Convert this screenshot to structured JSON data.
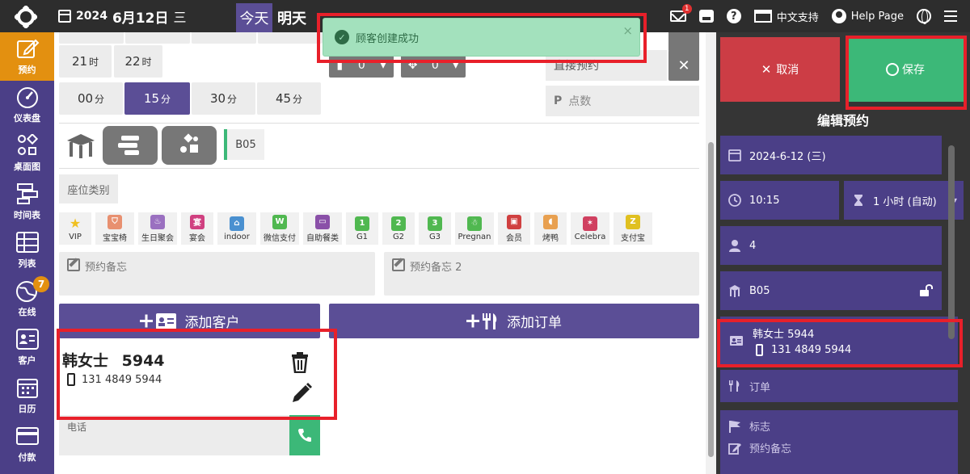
{
  "topbar": {
    "year": "2024",
    "month_day": "6月12日",
    "weekday": "三",
    "today_label": "今天",
    "tomorrow_label": "明天",
    "mail_badge": "1",
    "language_label": "中文支持",
    "help_label": "Help Page"
  },
  "sidebar": {
    "items": [
      {
        "label": "预约",
        "icon": "edit-icon"
      },
      {
        "label": "仪表盘",
        "icon": "dashboard-icon"
      },
      {
        "label": "桌面图",
        "icon": "floorplan-icon"
      },
      {
        "label": "时间表",
        "icon": "timeline-icon"
      },
      {
        "label": "列表",
        "icon": "list-icon"
      },
      {
        "label": "在线",
        "icon": "globe-icon",
        "badge": "7"
      },
      {
        "label": "客户",
        "icon": "customer-icon"
      },
      {
        "label": "日历",
        "icon": "calendar-icon"
      },
      {
        "label": "付款",
        "icon": "payment-icon"
      }
    ]
  },
  "time": {
    "hours": [
      {
        "num": "21",
        "unit": "时"
      },
      {
        "num": "22",
        "unit": "时"
      }
    ],
    "minutes": [
      {
        "num": "00",
        "unit": "分"
      },
      {
        "num": "15",
        "unit": "分",
        "selected": true
      },
      {
        "num": "30",
        "unit": "分"
      },
      {
        "num": "45",
        "unit": "分"
      }
    ]
  },
  "top_partial": {
    "spinner_a": "0",
    "spinner_b": "0",
    "direct_booking": "直接预约",
    "points_placeholder": "点数"
  },
  "table": {
    "number": "B05",
    "seat_category": "座位类别"
  },
  "tags": [
    {
      "label": "VIP",
      "icon": "star-icon",
      "color": "#f0c020",
      "glyph": "★"
    },
    {
      "label": "宝宝椅",
      "icon": "highchair-icon",
      "color": "#e89070",
      "glyph": "⛉"
    },
    {
      "label": "生日聚会",
      "icon": "cake-icon",
      "color": "#9a70c0",
      "glyph": "♨"
    },
    {
      "label": "宴会",
      "icon": "banquet-icon",
      "color": "#d04080",
      "glyph": "宴"
    },
    {
      "label": "indoor",
      "icon": "bed-icon",
      "color": "#4a90d0",
      "glyph": "⌂"
    },
    {
      "label": "微信支付",
      "icon": "wechat-icon",
      "color": "#50b850",
      "glyph": "W"
    },
    {
      "label": "自助餐类",
      "icon": "buffet-icon",
      "color": "#8a50a8",
      "glyph": "▭"
    },
    {
      "label": "G1",
      "icon": "g1-icon",
      "color": "#50b850",
      "glyph": "1"
    },
    {
      "label": "G2",
      "icon": "g2-icon",
      "color": "#50b850",
      "glyph": "2"
    },
    {
      "label": "G3",
      "icon": "g3-icon",
      "color": "#50b850",
      "glyph": "3"
    },
    {
      "label": "Pregnan",
      "icon": "pregnant-icon",
      "color": "#50b850",
      "glyph": "☃"
    },
    {
      "label": "会员",
      "icon": "member-card-icon",
      "color": "#d04040",
      "glyph": "▣"
    },
    {
      "label": "烤鸭",
      "icon": "drumstick-icon",
      "color": "#e8a050",
      "glyph": "◖"
    },
    {
      "label": "Celebra",
      "icon": "party-icon",
      "color": "#d04060",
      "glyph": "✶"
    },
    {
      "label": "支付宝",
      "icon": "alipay-icon",
      "color": "#e0c020",
      "glyph": "Z"
    }
  ],
  "notes": {
    "note1_placeholder": "预约备忘",
    "note2_placeholder": "预约备忘 2"
  },
  "buttons": {
    "add_customer": "添加客户",
    "add_order": "添加订单"
  },
  "customer": {
    "name": "韩女士",
    "id": "5944",
    "phone": "131 4849 5944",
    "phone_field_placeholder": "电话"
  },
  "toast": {
    "message": "顾客创建成功",
    "close": "×"
  },
  "right_panel": {
    "cancel_label": "取消",
    "save_label": "保存",
    "title": "编辑预约",
    "date": "2024-6-12 (三)",
    "time": "10:15",
    "duration": "1 小时 (自动)",
    "guests": "4",
    "table": "B05",
    "customer_name": "韩女士 5944",
    "customer_phone": "131 4849 5944",
    "order_label": "订单",
    "flag_label": "标志",
    "note_label": "预约备忘"
  },
  "colors": {
    "topbar": "#2d2d2d",
    "sidebar": "#4b3f87",
    "active": "#e39010",
    "accent_purple": "#5b4e96",
    "cancel_red": "#cc3d45",
    "save_green": "#3cb878",
    "toast_green": "#a3e1bd",
    "highlight_red": "#e8202a"
  }
}
